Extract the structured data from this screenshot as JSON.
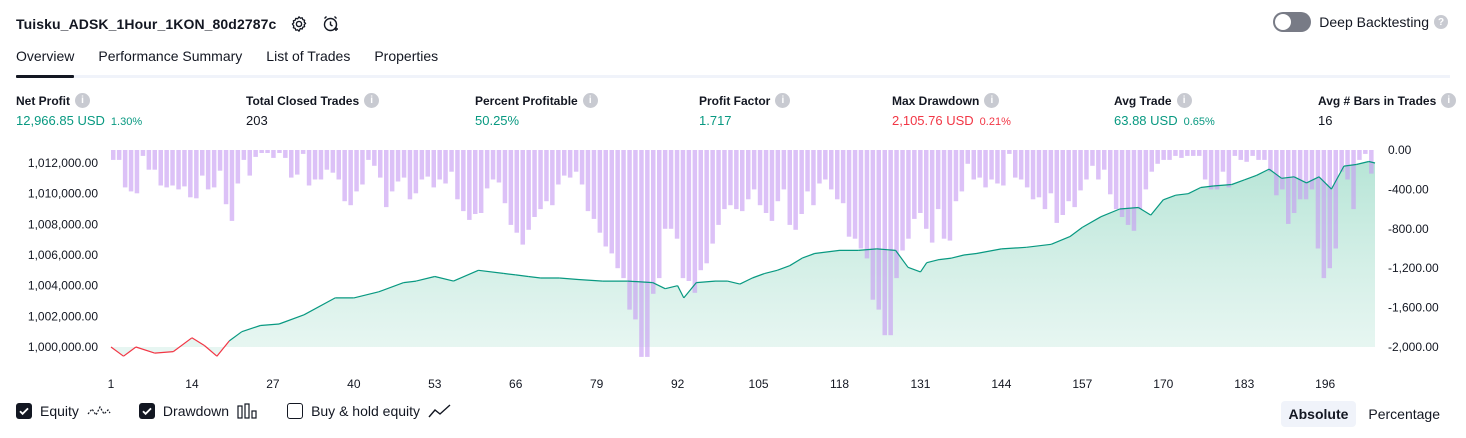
{
  "header": {
    "title": "Tuisku_ADSK_1Hour_1KON_80d2787c",
    "settings_icon": "gear-icon",
    "replay_icon": "add-alert-icon"
  },
  "deep_backtesting": {
    "label": "Deep Backtesting",
    "enabled": false
  },
  "tabs": [
    {
      "label": "Overview",
      "active": true
    },
    {
      "label": "Performance Summary",
      "active": false
    },
    {
      "label": "List of Trades",
      "active": false
    },
    {
      "label": "Properties",
      "active": false
    }
  ],
  "metrics": [
    {
      "label": "Net Profit",
      "value": "12,966.85 USD",
      "pct": "1.30%",
      "tone": "pos"
    },
    {
      "label": "Total Closed Trades",
      "value": "203",
      "pct": "",
      "tone": ""
    },
    {
      "label": "Percent Profitable",
      "value": "50.25%",
      "pct": "",
      "tone": "pos"
    },
    {
      "label": "Profit Factor",
      "value": "1.717",
      "pct": "",
      "tone": "pos"
    },
    {
      "label": "Max Drawdown",
      "value": "2,105.76 USD",
      "pct": "0.21%",
      "tone": "neg"
    },
    {
      "label": "Avg Trade",
      "value": "63.88 USD",
      "pct": "0.65%",
      "tone": "pos"
    },
    {
      "label": "Avg # Bars in Trades",
      "value": "16",
      "pct": "",
      "tone": ""
    }
  ],
  "chart_data": {
    "type": "area",
    "x_ticks": [
      "1",
      "14",
      "27",
      "40",
      "53",
      "66",
      "79",
      "92",
      "105",
      "118",
      "131",
      "144",
      "157",
      "170",
      "183",
      "196"
    ],
    "xlim": [
      1,
      204
    ],
    "left_axis": {
      "ticks": [
        "1,012,000.00",
        "1,010,000.00",
        "1,008,000.00",
        "1,006,000.00",
        "1,004,000.00",
        "1,002,000.00",
        "1,000,000.00"
      ],
      "ylim": [
        1000000,
        1012000
      ]
    },
    "right_axis": {
      "ticks": [
        "0.00",
        "-400.00",
        "-800.00",
        "-1,200.00",
        "-1,600.00",
        "-2,000.00"
      ],
      "ylim": [
        -2000,
        0
      ]
    },
    "equity": {
      "color_up": "#089981",
      "color_down": "#f23645",
      "x": [
        1,
        3,
        5,
        8,
        11,
        14,
        16,
        18,
        20,
        22,
        25,
        28,
        32,
        37,
        40,
        44,
        48,
        50,
        53,
        56,
        60,
        64,
        66,
        68,
        70,
        73,
        76,
        80,
        84,
        88,
        90,
        92,
        93,
        95,
        98,
        100,
        102,
        104,
        106,
        108,
        110,
        112,
        114,
        118,
        121,
        124,
        127,
        129,
        131,
        132,
        134,
        136,
        138,
        140,
        144,
        148,
        152,
        155,
        157,
        160,
        163,
        166,
        168,
        170,
        172,
        174,
        176,
        178,
        181,
        183,
        185,
        187,
        189,
        191,
        193,
        195,
        197,
        199,
        201,
        203,
        204
      ],
      "y": [
        1000000,
        999400,
        1000000,
        999600,
        999700,
        1000600,
        1000100,
        999400,
        1000400,
        1001000,
        1001400,
        1001500,
        1002100,
        1003200,
        1003200,
        1003600,
        1004200,
        1004300,
        1004600,
        1004300,
        1005000,
        1004800,
        1004700,
        1004600,
        1004500,
        1004500,
        1004400,
        1004300,
        1004300,
        1004200,
        1003800,
        1004000,
        1003200,
        1004200,
        1004300,
        1004300,
        1004100,
        1004500,
        1004800,
        1005000,
        1005300,
        1005800,
        1006100,
        1006300,
        1006300,
        1006400,
        1006300,
        1005200,
        1004900,
        1005500,
        1005700,
        1005800,
        1006000,
        1006100,
        1006400,
        1006500,
        1006700,
        1007200,
        1007800,
        1008500,
        1009000,
        1009100,
        1008600,
        1009600,
        1009900,
        1010000,
        1010400,
        1010500,
        1010600,
        1010900,
        1011200,
        1011600,
        1011000,
        1011100,
        1010700,
        1011100,
        1010300,
        1011800,
        1011900,
        1012100,
        1012000
      ]
    },
    "drawdown": {
      "color": "#c79bf2",
      "values": [
        -100,
        -100,
        -380,
        -420,
        -440,
        -60,
        -200,
        -200,
        -360,
        -380,
        -360,
        -400,
        -370,
        -480,
        -490,
        -260,
        -400,
        -380,
        -210,
        -550,
        -720,
        -340,
        -100,
        -260,
        -70,
        -30,
        -30,
        -80,
        -30,
        -80,
        -280,
        -250,
        -40,
        -360,
        -300,
        -300,
        -200,
        -230,
        -300,
        -520,
        -560,
        -420,
        -350,
        -100,
        -160,
        -280,
        -580,
        -420,
        -320,
        -280,
        -500,
        -440,
        -300,
        -270,
        -380,
        -300,
        -340,
        -220,
        -500,
        -620,
        -710,
        -650,
        -640,
        -390,
        -300,
        -330,
        -540,
        -760,
        -840,
        -960,
        -810,
        -680,
        -600,
        -520,
        -560,
        -350,
        -260,
        -280,
        -220,
        -350,
        -620,
        -700,
        -840,
        -980,
        -1050,
        -1200,
        -1300,
        -1620,
        -1720,
        -2100,
        -2100,
        -1460,
        -1300,
        -800,
        -800,
        -900,
        -1300,
        -1330,
        -1450,
        -1220,
        -1150,
        -950,
        -760,
        -600,
        -560,
        -600,
        -620,
        -500,
        -400,
        -560,
        -640,
        -720,
        -520,
        -400,
        -760,
        -810,
        -650,
        -420,
        -560,
        -340,
        -300,
        -400,
        -500,
        -540,
        -880,
        -900,
        -1000,
        -1100,
        -1520,
        -1620,
        -1880,
        -1880,
        -1300,
        -1020,
        -900,
        -700,
        -640,
        -800,
        -940,
        -600,
        -900,
        -920,
        -520,
        -420,
        -140,
        -300,
        -280,
        -380,
        -300,
        -340,
        -360,
        -40,
        -280,
        -300,
        -380,
        -500,
        -480,
        -600,
        -440,
        -740,
        -660,
        -520,
        -580,
        -410,
        -300,
        -160,
        -300,
        -200,
        -450,
        -600,
        -680,
        -760,
        -820,
        -600,
        -400,
        -220,
        -140,
        -100,
        -100,
        -60,
        -80,
        -60,
        -60,
        -60,
        -300,
        -400,
        -400,
        -220,
        -380,
        -60,
        -100,
        -120,
        -60,
        -100,
        -100,
        -220,
        -460,
        -400,
        -750,
        -640,
        -500,
        -500,
        -400,
        -1000,
        -1300,
        -1200,
        -1000,
        -220,
        -300,
        -600,
        -100,
        -40,
        -240
      ]
    }
  },
  "legend": [
    {
      "label": "Equity",
      "checked": true,
      "icon": "equity-wave-icon"
    },
    {
      "label": "Drawdown",
      "checked": true,
      "icon": "drawdown-bars-icon"
    },
    {
      "label": "Buy & hold equity",
      "checked": false,
      "icon": "buy-hold-line-icon"
    }
  ],
  "mode": {
    "absolute": "Absolute",
    "percentage": "Percentage",
    "selected": "Absolute"
  }
}
